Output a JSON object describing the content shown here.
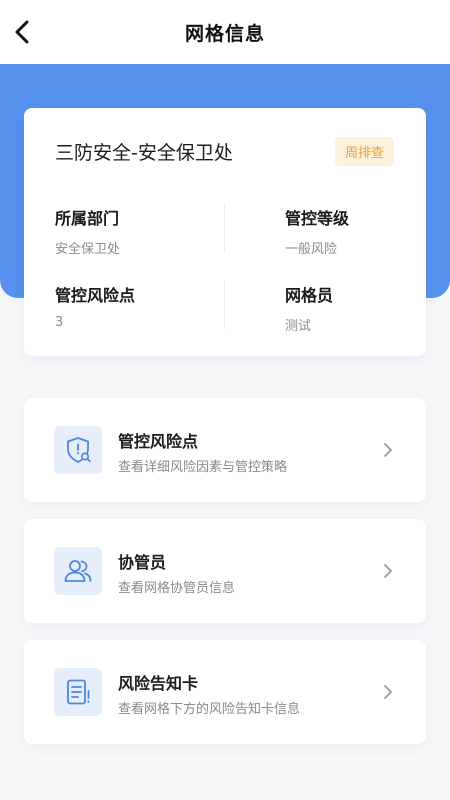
{
  "nav": {
    "title": "网格信息"
  },
  "grid": {
    "name": "三防安全-安全保卫处",
    "badge": "周排查",
    "fields": [
      {
        "label": "所属部门",
        "value": "安全保卫处"
      },
      {
        "label": "管控等级",
        "value": "一般风险"
      },
      {
        "label": "管控风险点",
        "value": "3"
      },
      {
        "label": "网格员",
        "value": "测试"
      }
    ]
  },
  "entries": [
    {
      "title": "管控风险点",
      "subtitle": "查看详细风险因素与管控策略",
      "icon": "shield-search-icon"
    },
    {
      "title": "协管员",
      "subtitle": "查看网格协管员信息",
      "icon": "users-icon"
    },
    {
      "title": "风险告知卡",
      "subtitle": "查看网格下方的风险告知卡信息",
      "icon": "document-alert-icon"
    }
  ],
  "colors": {
    "primary": "#5791ee",
    "badge_bg": "#fdf1dd",
    "badge_text": "#e9a23a",
    "icon_bg": "#e6eefc",
    "icon_stroke": "#4f86dd"
  }
}
